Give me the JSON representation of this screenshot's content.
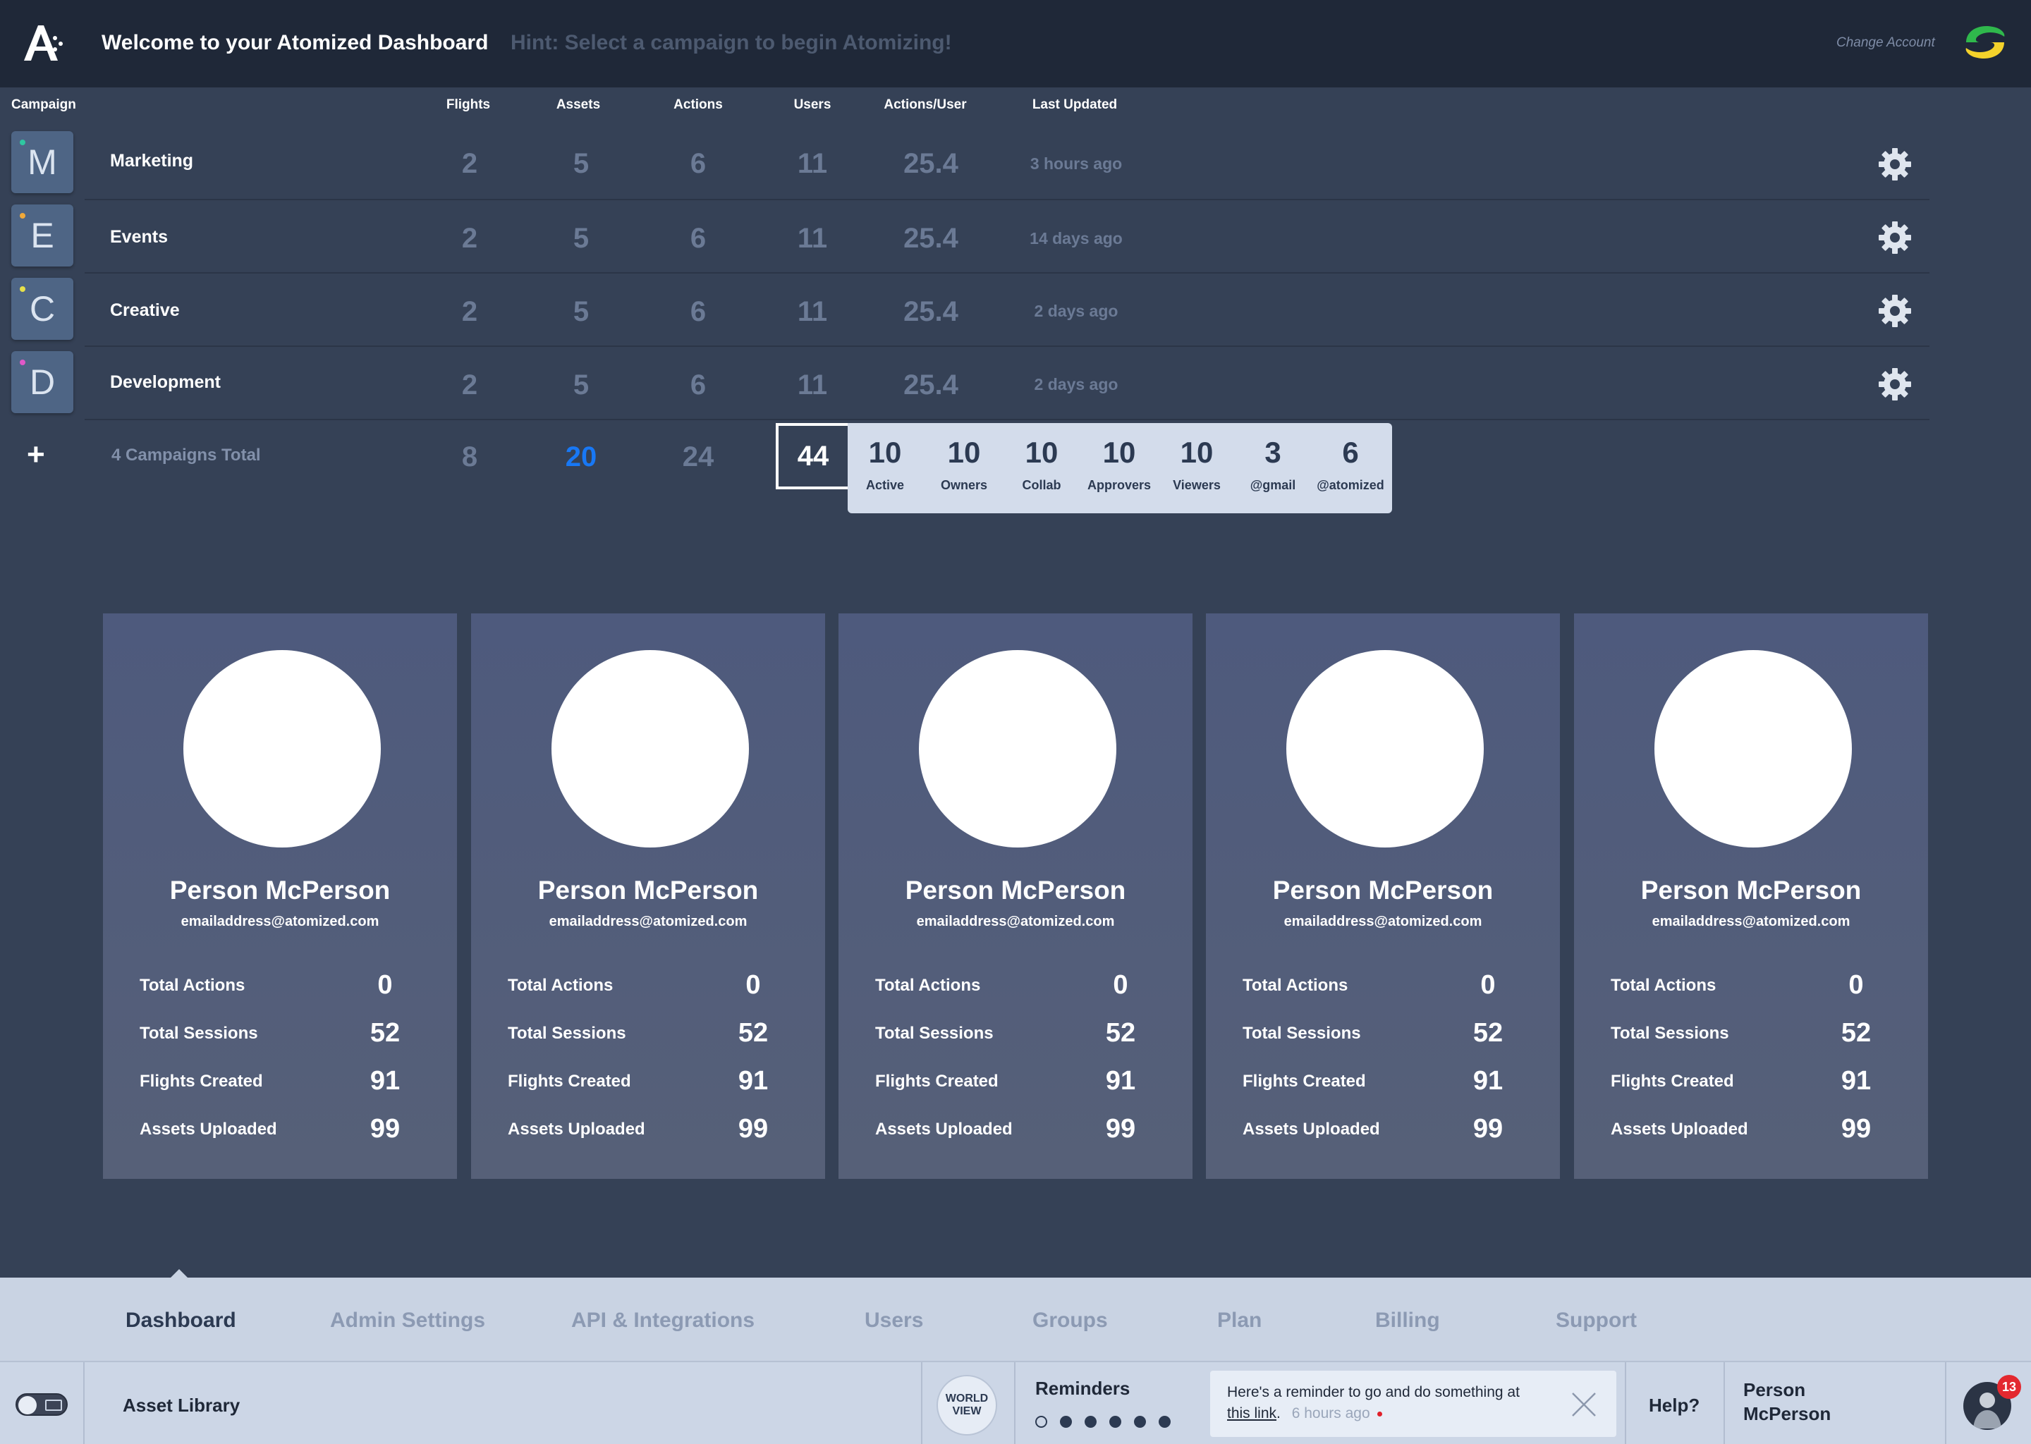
{
  "header": {
    "title": "Welcome to your Atomized Dashboard",
    "hint": "Hint: Select a campaign to begin Atomizing!",
    "change_account": "Change Account"
  },
  "table": {
    "columns": [
      "Campaign",
      "Flights",
      "Assets",
      "Actions",
      "Users",
      "Actions/User",
      "Last Updated"
    ],
    "rows": [
      {
        "initial": "M",
        "name": "Marketing",
        "flights": "2",
        "assets": "5",
        "actions": "6",
        "users": "11",
        "ratio": "25.4",
        "updated": "3 hours ago",
        "dot": "#2fc7a1"
      },
      {
        "initial": "E",
        "name": "Events",
        "flights": "2",
        "assets": "5",
        "actions": "6",
        "users": "11",
        "ratio": "25.4",
        "updated": "14 days ago",
        "dot": "#f0a93a"
      },
      {
        "initial": "C",
        "name": "Creative",
        "flights": "2",
        "assets": "5",
        "actions": "6",
        "users": "11",
        "ratio": "25.4",
        "updated": "2 days ago",
        "dot": "#e6e04a"
      },
      {
        "initial": "D",
        "name": "Development",
        "flights": "2",
        "assets": "5",
        "actions": "6",
        "users": "11",
        "ratio": "25.4",
        "updated": "2 days ago",
        "dot": "#e058c8"
      }
    ],
    "add_symbol": "+",
    "totals": {
      "label": "4 Campaigns Total",
      "flights": "8",
      "assets": "20",
      "actions": "24",
      "users": "44"
    },
    "user_breakdown": [
      {
        "value": "10",
        "label": "Active"
      },
      {
        "value": "10",
        "label": "Owners"
      },
      {
        "value": "10",
        "label": "Collab"
      },
      {
        "value": "10",
        "label": "Approvers"
      },
      {
        "value": "10",
        "label": "Viewers"
      },
      {
        "value": "3",
        "label": "@gmail"
      },
      {
        "value": "6",
        "label": "@atomized"
      }
    ]
  },
  "people": [
    {
      "name": "Person McPerson",
      "email": "emailaddress@atomized.com",
      "stats": [
        {
          "label": "Total Actions",
          "value": "0"
        },
        {
          "label": "Total Sessions",
          "value": "52"
        },
        {
          "label": "Flights Created",
          "value": "91"
        },
        {
          "label": "Assets Uploaded",
          "value": "99"
        }
      ]
    },
    {
      "name": "Person McPerson",
      "email": "emailaddress@atomized.com",
      "stats": [
        {
          "label": "Total Actions",
          "value": "0"
        },
        {
          "label": "Total Sessions",
          "value": "52"
        },
        {
          "label": "Flights Created",
          "value": "91"
        },
        {
          "label": "Assets Uploaded",
          "value": "99"
        }
      ]
    },
    {
      "name": "Person McPerson",
      "email": "emailaddress@atomized.com",
      "stats": [
        {
          "label": "Total Actions",
          "value": "0"
        },
        {
          "label": "Total Sessions",
          "value": "52"
        },
        {
          "label": "Flights Created",
          "value": "91"
        },
        {
          "label": "Assets Uploaded",
          "value": "99"
        }
      ]
    },
    {
      "name": "Person McPerson",
      "email": "emailaddress@atomized.com",
      "stats": [
        {
          "label": "Total Actions",
          "value": "0"
        },
        {
          "label": "Total Sessions",
          "value": "52"
        },
        {
          "label": "Flights Created",
          "value": "91"
        },
        {
          "label": "Assets Uploaded",
          "value": "99"
        }
      ]
    },
    {
      "name": "Person McPerson",
      "email": "emailaddress@atomized.com",
      "stats": [
        {
          "label": "Total Actions",
          "value": "0"
        },
        {
          "label": "Total Sessions",
          "value": "52"
        },
        {
          "label": "Flights Created",
          "value": "91"
        },
        {
          "label": "Assets Uploaded",
          "value": "99"
        }
      ]
    }
  ],
  "nav": {
    "items": [
      "Dashboard",
      "Admin Settings",
      "API & Integrations",
      "Users",
      "Groups",
      "Plan",
      "Billing",
      "Support"
    ],
    "active": "Dashboard"
  },
  "statusbar": {
    "asset_library": "Asset Library",
    "world_view_line1": "WORLD",
    "world_view_line2": "VIEW",
    "reminders_title": "Reminders",
    "reminder_text_before": "Here's a reminder to go and do something at",
    "reminder_link": "this link",
    "reminder_after": ".",
    "reminder_time": "6 hours ago",
    "help": "Help?",
    "user_first": "Person",
    "user_last": "McPerson",
    "notification_count": "13"
  },
  "colors": {
    "background": "#354156",
    "topbar": "#1f2838",
    "accent_blue": "#1878f5",
    "nav_bg": "#c9d3e3",
    "notification_red": "#e3282f"
  },
  "icons": [
    "atomized-logo-icon",
    "brand-badge-icon",
    "gear-icon",
    "plus-icon",
    "image-toggle-icon",
    "close-icon"
  ]
}
